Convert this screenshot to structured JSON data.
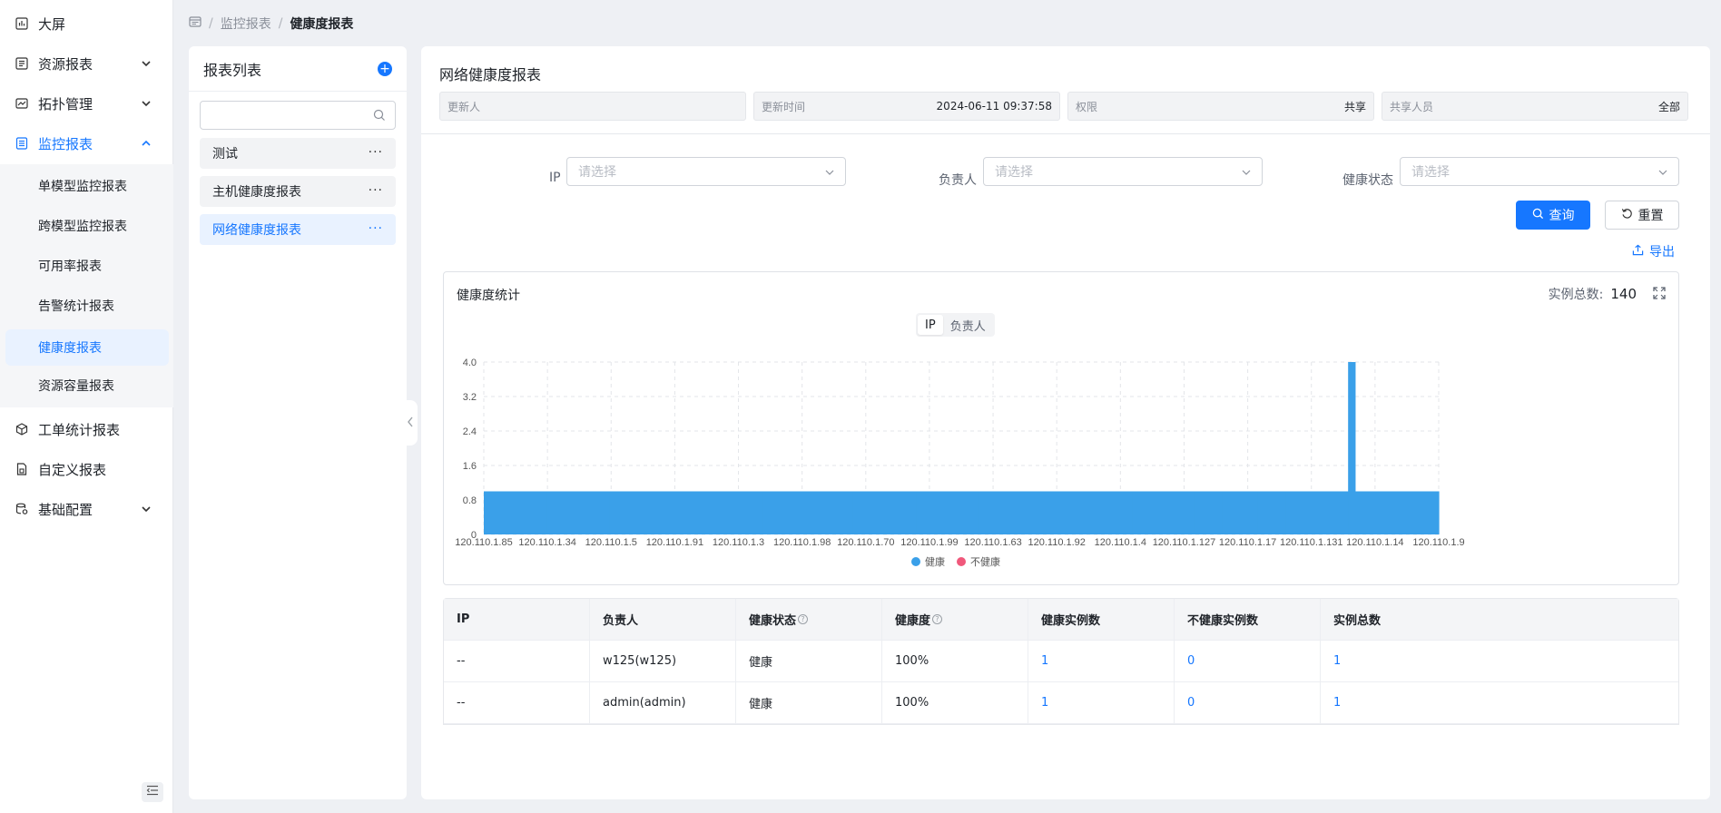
{
  "sidebar": {
    "items": [
      {
        "label": "大屏",
        "icon": "chart-bar-icon",
        "has_arrow": false
      },
      {
        "label": "资源报表",
        "icon": "resource-report-icon",
        "has_arrow": true
      },
      {
        "label": "拓扑管理",
        "icon": "topology-icon",
        "has_arrow": true
      },
      {
        "label": "监控报表",
        "icon": "monitor-report-icon",
        "has_arrow": true,
        "expanded": true,
        "active": true
      },
      {
        "label": "工单统计报表",
        "icon": "cube-icon",
        "has_arrow": false
      },
      {
        "label": "自定义报表",
        "icon": "document-icon",
        "has_arrow": false
      },
      {
        "label": "基础配置",
        "icon": "database-settings-icon",
        "has_arrow": true
      }
    ],
    "submenu": [
      {
        "label": "单模型监控报表"
      },
      {
        "label": "跨模型监控报表"
      },
      {
        "label": "可用率报表"
      },
      {
        "label": "告警统计报表"
      },
      {
        "label": "健康度报表",
        "active": true
      },
      {
        "label": "资源容量报表"
      }
    ]
  },
  "breadcrumb": {
    "home_icon": "home-icon",
    "level1": "监控报表",
    "current": "健康度报表",
    "separator": "/"
  },
  "report_list": {
    "title": "报表列表",
    "add_symbol": "+",
    "search_placeholder": "",
    "more_symbol": "···",
    "items": [
      {
        "label": "测试"
      },
      {
        "label": "主机健康度报表"
      },
      {
        "label": "网络健康度报表",
        "active": true
      }
    ]
  },
  "main": {
    "title": "网络健康度报表",
    "meta": [
      {
        "label": "更新人",
        "value": ""
      },
      {
        "label": "更新时间",
        "value": "2024-06-11 09:37:58"
      },
      {
        "label": "权限",
        "value": "共享"
      },
      {
        "label": "共享人员",
        "value": "全部"
      }
    ],
    "filters": [
      {
        "label": "IP",
        "placeholder": "请选择"
      },
      {
        "label": "负责人",
        "placeholder": "请选择"
      },
      {
        "label": "健康状态",
        "placeholder": "请选择"
      }
    ],
    "query_button": "查询",
    "reset_button": "重置",
    "export_link": "导出"
  },
  "chart_card": {
    "title": "健康度统计",
    "total_label": "实例总数:",
    "total_value": "140",
    "toggle": [
      {
        "label": "IP",
        "active": true
      },
      {
        "label": "负责人",
        "active": false
      }
    ],
    "colors": {
      "healthy": "#3aa0e9",
      "unhealthy": "#f0587b"
    }
  },
  "chart_data": {
    "type": "bar",
    "stacked": true,
    "title": "",
    "xlabel": "",
    "ylabel": "",
    "ylim": [
      0,
      4.0
    ],
    "yticks": [
      "0",
      "0.8",
      "1.6",
      "2.4",
      "3.2",
      "4.0"
    ],
    "grid": true,
    "legend_position": "bottom",
    "xtick_labels": [
      "120.110.1.85",
      "120.110.1.34",
      "120.110.1.5",
      "120.110.1.91",
      "120.110.1.3",
      "120.110.1.98",
      "120.110.1.70",
      "120.110.1.99",
      "120.110.1.63",
      "120.110.1.92",
      "120.110.1.4",
      "120.110.1.127",
      "120.110.1.17",
      "120.110.1.131",
      "120.110.1.14",
      "120.110.1.9"
    ],
    "category_count": 137,
    "series": [
      {
        "name": "健康",
        "color": "#3aa0e9",
        "default_value": 1,
        "overrides": [
          {
            "category_index": 124,
            "value": 4
          }
        ]
      },
      {
        "name": "不健康",
        "color": "#f0587b",
        "default_value": 0
      }
    ]
  },
  "table": {
    "columns": [
      {
        "label": "IP",
        "help": false
      },
      {
        "label": "负责人",
        "help": false
      },
      {
        "label": "健康状态",
        "help": true
      },
      {
        "label": "健康度",
        "help": true
      },
      {
        "label": "健康实例数",
        "help": false
      },
      {
        "label": "不健康实例数",
        "help": false
      },
      {
        "label": "实例总数",
        "help": false
      }
    ],
    "help_symbol": "?",
    "rows": [
      [
        "--",
        "w125(w125)",
        "健康",
        "100%",
        "1",
        "0",
        "1"
      ],
      [
        "--",
        "admin(admin)",
        "健康",
        "100%",
        "1",
        "0",
        "1"
      ]
    ]
  }
}
